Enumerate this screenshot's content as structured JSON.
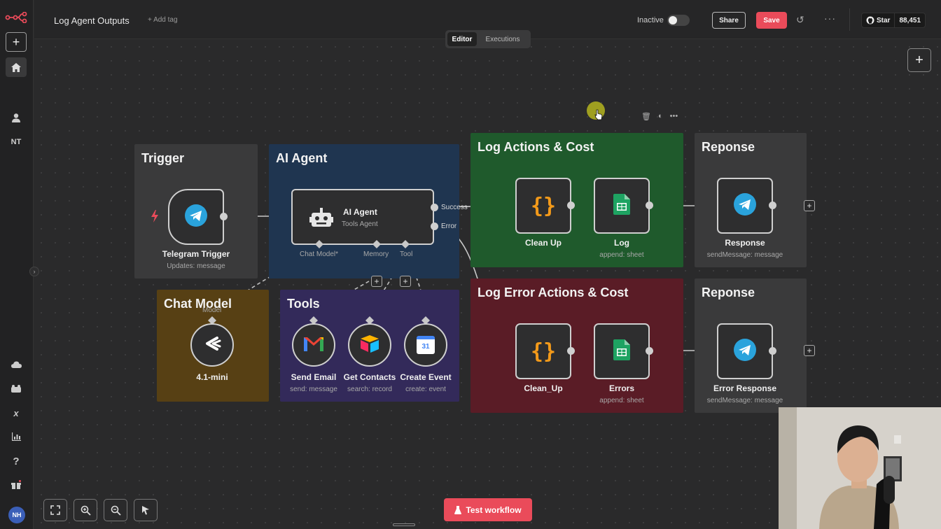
{
  "app": {
    "workflow_title": "Log Agent Outputs",
    "add_tag": "+ Add tag",
    "status_label": "Inactive",
    "share_label": "Share",
    "save_label": "Save",
    "github_star": "Star",
    "github_count": "88,451"
  },
  "tabs": [
    {
      "label": "Editor",
      "active": true
    },
    {
      "label": "Executions",
      "active": false
    }
  ],
  "sidebar": {
    "user_initials": "NT",
    "avatar_initials": "NH"
  },
  "groups": {
    "trigger": "Trigger",
    "ai_agent": "AI Agent",
    "log_actions": "Log Actions & Cost",
    "response_top": "Reponse",
    "chat_model": "Chat Model",
    "tools": "Tools",
    "log_error": "Log Error Actions & Cost",
    "response_bottom": "Reponse"
  },
  "nodes": {
    "telegram_trigger": {
      "label": "Telegram Trigger",
      "sub": "Updates: message"
    },
    "ai_agent": {
      "label": "AI Agent",
      "sub": "Tools Agent",
      "ports": {
        "chat_model": "Chat Model*",
        "memory": "Memory",
        "tool": "Tool"
      },
      "outputs": {
        "success": "Success",
        "error": "Error"
      }
    },
    "clean_up": {
      "label": "Clean Up"
    },
    "log": {
      "label": "Log",
      "sub": "append: sheet"
    },
    "response": {
      "label": "Response",
      "sub": "sendMessage: message"
    },
    "chat_model": {
      "label": "4.1-mini",
      "port": "Model"
    },
    "send_email": {
      "label": "Send Email",
      "sub": "send: message"
    },
    "get_contacts": {
      "label": "Get Contacts",
      "sub": "search: record"
    },
    "create_event": {
      "label": "Create Event",
      "sub": "create: event",
      "icon_text": "31"
    },
    "clean_up2": {
      "label": "Clean_Up"
    },
    "errors": {
      "label": "Errors",
      "sub": "append: sheet"
    },
    "error_response": {
      "label": "Error Response",
      "sub": "sendMessage: message"
    }
  },
  "bottom": {
    "test_workflow": "Test workflow"
  },
  "colors": {
    "accent": "#ea4b5a",
    "group_trigger": "#3a3a3b",
    "group_agent": "#1f3550",
    "group_log": "#1f5a2c",
    "group_error": "#5a1c26",
    "group_chat": "#574014",
    "group_tools": "#332a5a"
  }
}
